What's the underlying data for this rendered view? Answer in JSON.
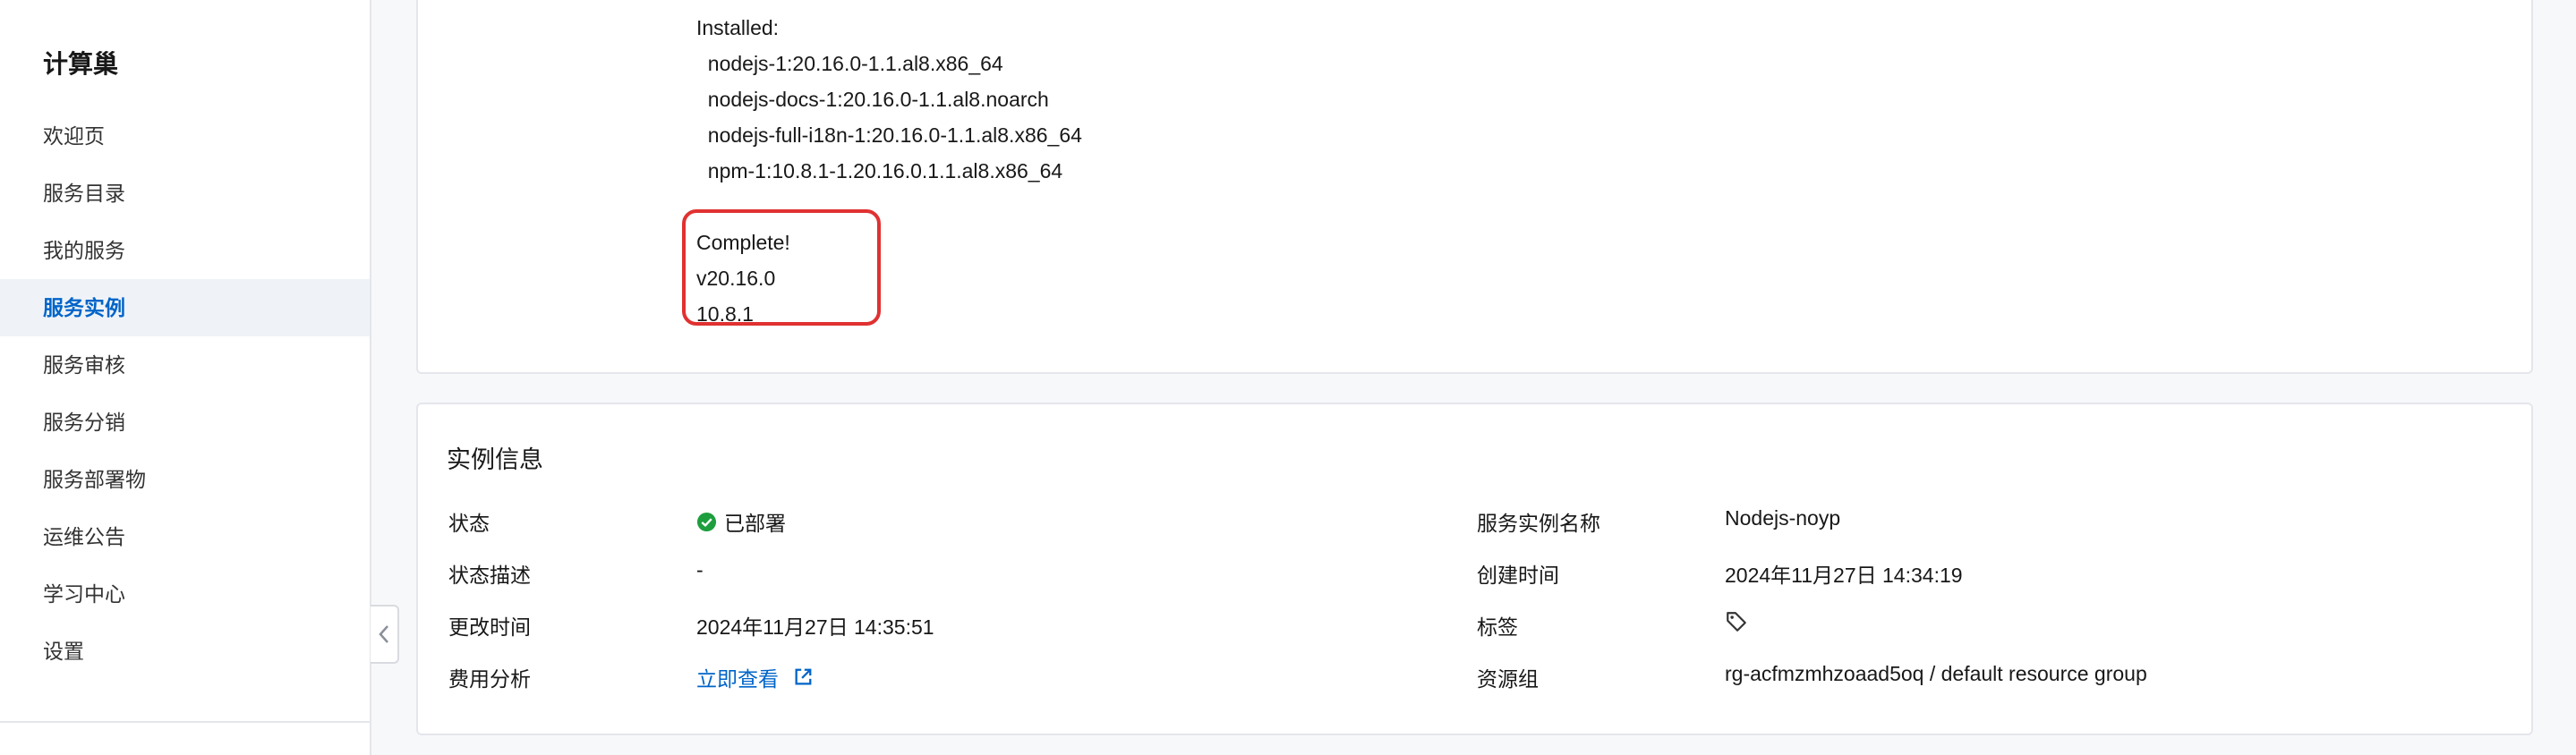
{
  "sidebar": {
    "title": "计算巢",
    "items": [
      {
        "label": "欢迎页"
      },
      {
        "label": "服务目录"
      },
      {
        "label": "我的服务"
      },
      {
        "label": "服务实例",
        "active": true
      },
      {
        "label": "服务审核"
      },
      {
        "label": "服务分销"
      },
      {
        "label": "服务部署物"
      },
      {
        "label": "运维公告"
      },
      {
        "label": "学习中心"
      },
      {
        "label": "设置"
      }
    ]
  },
  "log": {
    "lines": [
      "Installed:",
      "  nodejs-1:20.16.0-1.1.al8.x86_64",
      "  nodejs-docs-1:20.16.0-1.1.al8.noarch",
      "  nodejs-full-i18n-1:20.16.0-1.1.al8.x86_64",
      "  npm-1:10.8.1-1.20.16.0.1.1.al8.x86_64"
    ],
    "highlighted": [
      "Complete!",
      "v20.16.0",
      "10.8.1"
    ]
  },
  "instance_info": {
    "title": "实例信息",
    "status_label": "状态",
    "status_value": "已部署",
    "status_desc_label": "状态描述",
    "status_desc_value": "-",
    "modified_label": "更改时间",
    "modified_value": "2024年11月27日 14:35:51",
    "cost_label": "费用分析",
    "cost_link": "立即查看",
    "name_label": "服务实例名称",
    "name_value": "Nodejs-noyp",
    "created_label": "创建时间",
    "created_value": "2024年11月27日 14:34:19",
    "tags_label": "标签",
    "resource_group_label": "资源组",
    "resource_group_value": "rg-acfmzmhzoaad5oq / default resource group"
  },
  "colors": {
    "accent": "#0064c8",
    "success": "#1e9e3e",
    "highlight": "#e03131"
  }
}
